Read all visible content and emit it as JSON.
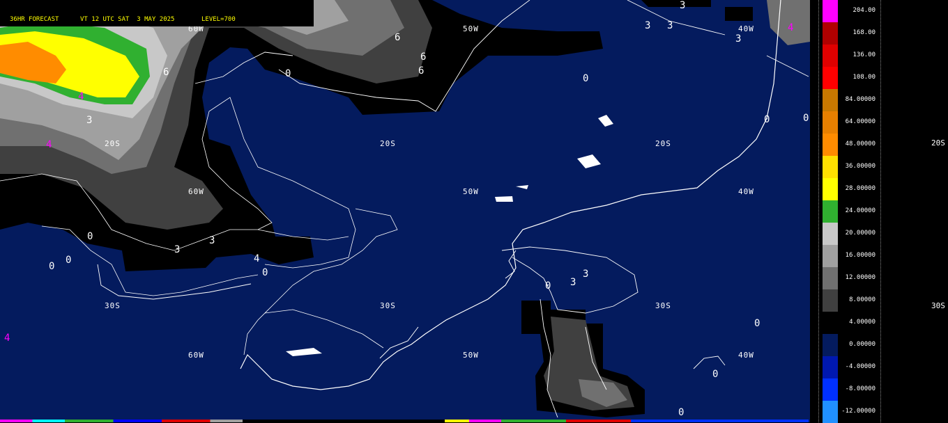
{
  "header": {
    "forecast": "36HR FORECAST",
    "valid": "VT 12 UTC SAT  3 MAY 2025",
    "level": "LEVEL=700"
  },
  "colors": {
    "ocean": "#041b5e",
    "coast": "#ffffff",
    "accent_text": "#ffff00"
  },
  "grid_labels": {
    "lat": [
      "20S",
      "20S",
      "20S",
      "30S",
      "30S",
      "30S",
      "20S",
      "30S"
    ],
    "lon": [
      "60W",
      "50W",
      "40W",
      "60W",
      "50W",
      "40W",
      "60W",
      "50W",
      "40W",
      "40W"
    ]
  },
  "contour_values": [
    "6",
    "6",
    "6",
    "6",
    "0",
    "0",
    "0",
    "0",
    "0",
    "3",
    "3",
    "3",
    "3",
    "3",
    "3",
    "3",
    "4",
    "4",
    "4",
    "0",
    "0",
    "0",
    "0",
    "3",
    "3",
    "0",
    "0",
    "0",
    "4",
    "4"
  ],
  "legend": {
    "entries": [
      {
        "label": "204.00",
        "color": "#ff00ff"
      },
      {
        "label": "168.00",
        "color": "#b00000"
      },
      {
        "label": "136.00",
        "color": "#e00000"
      },
      {
        "label": "108.00",
        "color": "#ff0000"
      },
      {
        "label": "84.00000",
        "color": "#c87800"
      },
      {
        "label": "64.00000",
        "color": "#e88000"
      },
      {
        "label": "48.00000",
        "color": "#ff8c00"
      },
      {
        "label": "36.00000",
        "color": "#ffe000"
      },
      {
        "label": "28.00000",
        "color": "#ffff00"
      },
      {
        "label": "24.00000",
        "color": "#30b030"
      },
      {
        "label": "20.00000",
        "color": "#c8c8c8"
      },
      {
        "label": "16.00000",
        "color": "#a0a0a0"
      },
      {
        "label": "12.00000",
        "color": "#707070"
      },
      {
        "label": "8.00000",
        "color": "#404040"
      },
      {
        "label": "4.00000",
        "color": "#000000"
      },
      {
        "label": "0.00000",
        "color": "#041b5e"
      },
      {
        "label": "-4.00000",
        "color": "#0018b0"
      },
      {
        "label": "-8.00000",
        "color": "#0030ff"
      },
      {
        "label": "-12.00000",
        "color": "#2090ff"
      }
    ],
    "offscreen_labels": [
      "20S",
      "30S"
    ]
  }
}
